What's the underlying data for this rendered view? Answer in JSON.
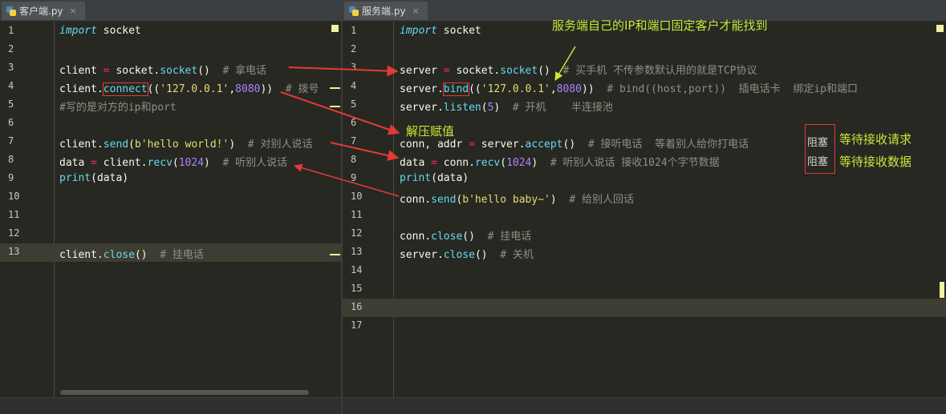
{
  "tabs": {
    "left": {
      "label": "客户端.py",
      "close": "×"
    },
    "right": {
      "label": "服务端.py",
      "close": "×"
    }
  },
  "left_lines": [
    "1",
    "2",
    "3",
    "4",
    "5",
    "6",
    "7",
    "8",
    "9",
    "10",
    "11",
    "12",
    "13"
  ],
  "right_lines": [
    "1",
    "2",
    "3",
    "4",
    "5",
    "6",
    "7",
    "8",
    "9",
    "10",
    "11",
    "12",
    "13",
    "14",
    "15",
    "16",
    "17"
  ],
  "client": {
    "l1_kw": "import",
    "l1_rest": " socket",
    "l3_a": "client ",
    "l3_op": "=",
    "l3_b": " socket.",
    "l3_fn": "socket",
    "l3_c": "()  ",
    "l3_cm": "# 拿电话",
    "l4_a": "client.",
    "l4_fn": "connect",
    "l4_b": "((",
    "l4_str": "'127.0.0.1'",
    "l4_c": ",",
    "l4_num": "8080",
    "l4_d": "))  ",
    "l4_cm": "# 拨号",
    "l5_cm": "#写的是对方的ip和port",
    "l7_a": "client.",
    "l7_fn": "send",
    "l7_b": "(",
    "l7_str": "b'hello world!'",
    "l7_c": ")  ",
    "l7_cm": "# 对别人说话",
    "l8_a": "data ",
    "l8_op": "=",
    "l8_b": " client.",
    "l8_fn": "recv",
    "l8_c": "(",
    "l8_num": "1024",
    "l8_d": ")  ",
    "l8_cm": "# 听别人说话",
    "l9_fn": "print",
    "l9_b": "(data)",
    "l13_a": "client.",
    "l13_fn": "close",
    "l13_b": "()  ",
    "l13_cm": "# 挂电话"
  },
  "server": {
    "l1_kw": "import",
    "l1_rest": " socket",
    "l3_a": "server ",
    "l3_op": "=",
    "l3_b": " socket.",
    "l3_fn": "socket",
    "l3_c": "()  ",
    "l3_cm": "# 买手机 不传参数默认用的就是TCP协议",
    "l4_a": "server.",
    "l4_fn": "bind",
    "l4_b": "((",
    "l4_str": "'127.0.0.1'",
    "l4_c": ",",
    "l4_num": "8080",
    "l4_d": "))  ",
    "l4_cm": "# bind((host,port))  插电话卡  绑定ip和端口",
    "l5_a": "server.",
    "l5_fn": "listen",
    "l5_b": "(",
    "l5_num": "5",
    "l5_c": ")  ",
    "l5_cm": "# 开机    半连接池",
    "l7_a": "conn, addr ",
    "l7_op": "=",
    "l7_b": " server.",
    "l7_fn": "accept",
    "l7_c": "()  ",
    "l7_cm": "# 接听电话  等着别人给你打电话",
    "l8_a": "data ",
    "l8_op": "=",
    "l8_b": " conn.",
    "l8_fn": "recv",
    "l8_c": "(",
    "l8_num": "1024",
    "l8_d": ")  ",
    "l8_cm": "# 听别人说话 接收1024个字节数据",
    "l9_fn": "print",
    "l9_b": "(data)",
    "l10_a": "conn.",
    "l10_fn": "send",
    "l10_b": "(",
    "l10_str": "b'hello baby~'",
    "l10_c": ")  ",
    "l10_cm": "# 给别人回话",
    "l12_a": "conn.",
    "l12_fn": "close",
    "l12_b": "()  ",
    "l12_cm": "# 挂电话",
    "l13_a": "server.",
    "l13_fn": "close",
    "l13_b": "()  ",
    "l13_cm": "# 关机"
  },
  "annotations": {
    "server_ip_note": "服务端自己的IP和端口固定客户才能找到",
    "unpack_note": "解压赋值",
    "wait_request": "等待接收请求",
    "wait_data": "等待接收数据",
    "block1": "阻塞",
    "block2": "阻塞"
  },
  "colors": {
    "annotation": "#c6e83a",
    "arrow": "#e53935",
    "pointer": "#c6e83a"
  }
}
